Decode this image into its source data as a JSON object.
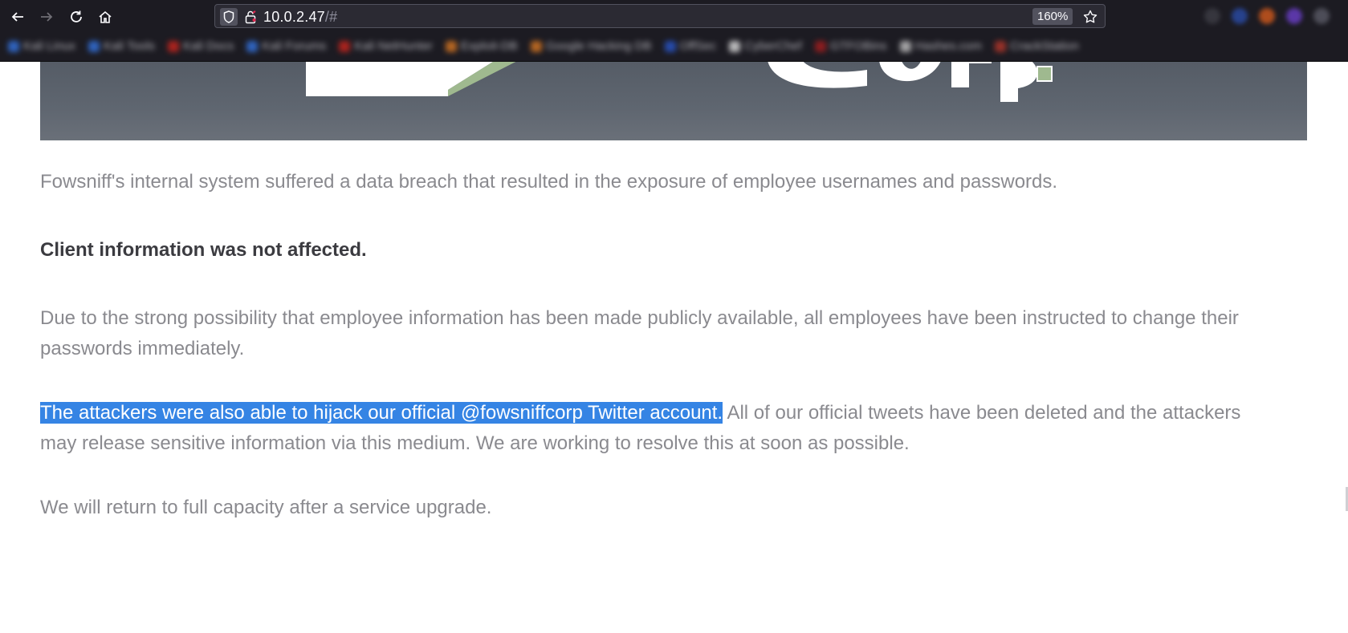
{
  "browser": {
    "url_host": "10.0.2.47",
    "url_path": "/#",
    "zoom": "160%",
    "bookmarks": [
      "Kali Linux",
      "Kali Tools",
      "Kali Docs",
      "Kali Forums",
      "Kali NetHunter",
      "Exploit-DB",
      "Google Hacking DB",
      "OffSec",
      "CyberChef",
      "GTFOBins",
      "Hashes.com",
      "CrackStation"
    ]
  },
  "page": {
    "p1": "Fowsniff's internal system suffered a data breach that resulted in the exposure of employee usernames and passwords.",
    "p2": "Client information was not affected.",
    "p3": "Due to the strong possibility that employee information has been made publicly available, all employees have been instructed to change their passwords immediately.",
    "p4_selected": "The attackers were also able to hijack our official @fowsniffcorp Twitter account.",
    "p4_rest": " All of our official tweets have been deleted and the attackers may release sensitive information via this medium. We are working to resolve this at soon as possible.",
    "p5": "We will return to full capacity after a service upgrade."
  }
}
